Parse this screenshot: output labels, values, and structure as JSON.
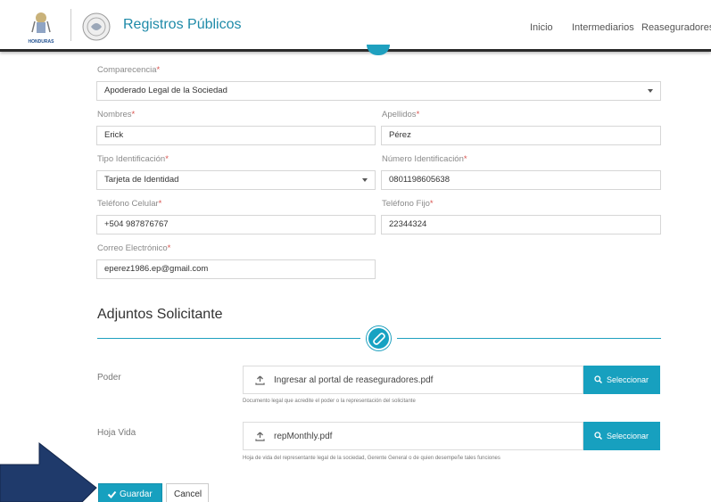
{
  "header": {
    "logo_text": "HONDURAS",
    "brand": "Registros Públicos",
    "nav": [
      "Inicio",
      "Intermediarios",
      "Reaseguradores"
    ]
  },
  "form": {
    "comparecencia": {
      "label": "Comparecencia",
      "value": "Apoderado Legal de la Sociedad"
    },
    "nombres": {
      "label": "Nombres",
      "value": "Erick"
    },
    "apellidos": {
      "label": "Apellidos",
      "value": "Pérez"
    },
    "tipo_id": {
      "label": "Tipo Identificación",
      "value": "Tarjeta de Identidad"
    },
    "numero_id": {
      "label": "Número Identificación",
      "value": "0801198605638"
    },
    "tel_celular": {
      "label": "Teléfono Celular",
      "value": "+504 987876767"
    },
    "tel_fijo": {
      "label": "Teléfono Fijo",
      "value": "22344324"
    },
    "correo": {
      "label": "Correo Electrónico",
      "value": "eperez1986.ep@gmail.com"
    },
    "required_mark": "*"
  },
  "attachments": {
    "title": "Adjuntos Solicitante",
    "items": [
      {
        "label": "Poder",
        "file": "Ingresar al portal de reaseguradores.pdf",
        "button": "Seleccionar",
        "help": "Documento legal que acredite el poder o la representación del solicitante"
      },
      {
        "label": "Hoja Vida",
        "file": "repMonthly.pdf",
        "button": "Seleccionar",
        "help": "Hoja de vida del representante legal de la sociedad, Gerente General o de quien desempeñe tales funciones"
      }
    ]
  },
  "actions": {
    "save": "Guardar",
    "cancel": "Cancel"
  },
  "colors": {
    "accent": "#17a0bf",
    "arrow": "#1f3a6b",
    "required": "#d9534f"
  }
}
